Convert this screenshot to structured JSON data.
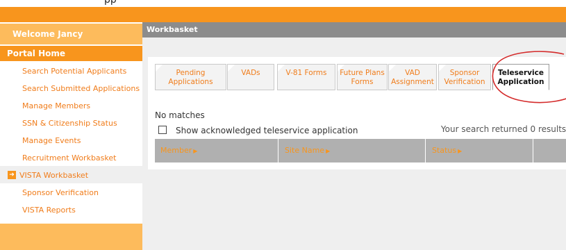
{
  "top_strip_text": "pp",
  "sidebar": {
    "welcome": "Welcome Jancy",
    "portal_home": "Portal Home",
    "items": [
      {
        "label": "Search Potential Applicants"
      },
      {
        "label": "Search Submitted Applications"
      },
      {
        "label": "Manage Members"
      },
      {
        "label": "SSN & Citizenship Status"
      },
      {
        "label": "Manage Events"
      },
      {
        "label": "Recruitment Workbasket"
      },
      {
        "label": "VISTA Workbasket",
        "active": true
      },
      {
        "label": "Sponsor Verification"
      },
      {
        "label": "VISTA Reports"
      }
    ]
  },
  "main": {
    "header": "Workbasket",
    "tabs": [
      {
        "label": "Pending Applications"
      },
      {
        "label": "VADs"
      },
      {
        "label": "V-81 Forms"
      },
      {
        "label": "Future Plans Forms"
      },
      {
        "label": "VAD Assignment"
      },
      {
        "label": "Sponsor Verification"
      },
      {
        "label": "Teleservice Application",
        "active": true
      }
    ],
    "no_matches": "No matches",
    "show_ack_label": "Show acknowledged teleservice application",
    "show_ack_checked": false,
    "results_text": "Your search returned 0 results.",
    "columns": [
      {
        "label": "Member"
      },
      {
        "label": "Site Name"
      },
      {
        "label": "Status"
      },
      {
        "label": ""
      }
    ]
  },
  "colors": {
    "brand_orange": "#f8951d",
    "light_orange": "#fdbb5c",
    "header_gray": "#8c8c8c",
    "annotation_red": "#d42a2a"
  },
  "icons": {
    "nav_active": "arrow-right-icon",
    "sort": "triangle-right-icon"
  }
}
